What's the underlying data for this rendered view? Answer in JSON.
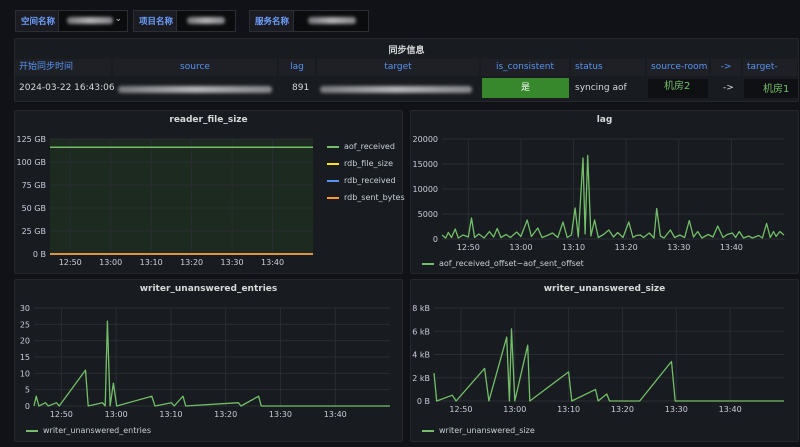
{
  "variables": [
    {
      "label": "空间名称"
    },
    {
      "label": "项目名称"
    },
    {
      "label": "服务名称"
    }
  ],
  "sync_table": {
    "title": "同步信息",
    "columns": [
      "开始同步时间",
      "source",
      "lag",
      "target",
      "is_consistent",
      "status",
      "source-room",
      "->",
      "target-room"
    ],
    "row": {
      "start_time": "2024-03-22 16:43:06",
      "lag": "891",
      "is_consistent": "是",
      "status": "syncing aof",
      "source_room": "机房2",
      "arrow": "->",
      "target_room": "机房1"
    },
    "colors": {
      "consistent_bg": "#37872d",
      "room_text": "#73bf69",
      "header_text": "#5794f2"
    }
  },
  "x_ticks": [
    "12:50",
    "13:00",
    "13:10",
    "13:20",
    "13:30",
    "13:40"
  ],
  "panels": {
    "reader": {
      "title": "reader_file_size"
    },
    "lag": {
      "title": "lag"
    },
    "writer_entries": {
      "title": "writer_unanswered_entries"
    },
    "writer_size": {
      "title": "writer_unanswered_size"
    }
  },
  "chart_data": [
    {
      "type": "line",
      "title": "reader_file_size",
      "x_range": [
        "12:45",
        "13:47"
      ],
      "ylim": [
        0,
        125
      ],
      "y_ticks": [
        "0 B",
        "25 GB",
        "50 GB",
        "75 GB",
        "100 GB",
        "125 GB"
      ],
      "legend_position": "right",
      "series": [
        {
          "name": "aof_received",
          "color": "#73bf69",
          "constant": 116
        },
        {
          "name": "rdb_file_size",
          "color": "#fade2a",
          "constant": 0
        },
        {
          "name": "rdb_received",
          "color": "#5794f2",
          "constant": 0
        },
        {
          "name": "rdb_sent_bytes",
          "color": "#ff9830",
          "constant": 0
        }
      ]
    },
    {
      "type": "line",
      "title": "lag",
      "x_range": [
        "12:45",
        "13:47"
      ],
      "ylim": [
        0,
        20000
      ],
      "y_ticks": [
        "0",
        "5000",
        "10000",
        "15000",
        "20000"
      ],
      "legend_position": "bottom",
      "series": [
        {
          "name": "aof_received_offset−aof_sent_offset",
          "color": "#73bf69",
          "points": [
            [
              0,
              800
            ],
            [
              0.7,
              200
            ],
            [
              1.2,
              1300
            ],
            [
              1.8,
              300
            ],
            [
              2.5,
              2000
            ],
            [
              3.1,
              200
            ],
            [
              4,
              800
            ],
            [
              5,
              400
            ],
            [
              5.6,
              4200
            ],
            [
              6.2,
              300
            ],
            [
              7,
              1000
            ],
            [
              8,
              200
            ],
            [
              9,
              1500
            ],
            [
              9.8,
              400
            ],
            [
              10.5,
              2100
            ],
            [
              11.2,
              300
            ],
            [
              12.2,
              900
            ],
            [
              13,
              300
            ],
            [
              14.2,
              1400
            ],
            [
              15,
              500
            ],
            [
              16.2,
              3800
            ],
            [
              17,
              500
            ],
            [
              18.2,
              2200
            ],
            [
              19,
              300
            ],
            [
              20,
              700
            ],
            [
              21,
              1200
            ],
            [
              22,
              300
            ],
            [
              23,
              3400
            ],
            [
              23.8,
              300
            ],
            [
              24.6,
              800
            ],
            [
              25.3,
              6200
            ],
            [
              25.9,
              400
            ],
            [
              26.8,
              16200
            ],
            [
              27.2,
              1000
            ],
            [
              27.7,
              16700
            ],
            [
              28.3,
              600
            ],
            [
              29,
              3800
            ],
            [
              29.7,
              300
            ],
            [
              30.7,
              900
            ],
            [
              31.7,
              1800
            ],
            [
              32.6,
              400
            ],
            [
              33.4,
              1300
            ],
            [
              34.4,
              300
            ],
            [
              35.5,
              3400
            ],
            [
              36.3,
              300
            ],
            [
              36.9,
              700
            ],
            [
              37.7,
              800
            ],
            [
              38.3,
              300
            ],
            [
              39.4,
              1200
            ],
            [
              40.3,
              200
            ],
            [
              40.8,
              6100
            ],
            [
              41.5,
              600
            ],
            [
              42.2,
              200
            ],
            [
              43.4,
              1800
            ],
            [
              44.2,
              300
            ],
            [
              45.2,
              800
            ],
            [
              46.1,
              300
            ],
            [
              47,
              3700
            ],
            [
              47.8,
              400
            ],
            [
              48.6,
              1500
            ],
            [
              49.4,
              200
            ],
            [
              50.6,
              900
            ],
            [
              51.5,
              400
            ],
            [
              52.4,
              2600
            ],
            [
              53.4,
              300
            ],
            [
              54.2,
              900
            ],
            [
              55.2,
              1200
            ],
            [
              55.8,
              300
            ],
            [
              56.5,
              1500
            ],
            [
              57.3,
              200
            ],
            [
              58.3,
              600
            ],
            [
              59,
              200
            ],
            [
              60.2,
              700
            ],
            [
              60.9,
              200
            ],
            [
              61.7,
              3100
            ],
            [
              62.4,
              300
            ],
            [
              63,
              1500
            ],
            [
              63.5,
              500
            ],
            [
              64.2,
              1500
            ],
            [
              65,
              800
            ]
          ]
        }
      ]
    },
    {
      "type": "line",
      "title": "writer_unanswered_entries",
      "x_range": [
        "12:45",
        "13:47"
      ],
      "ylim": [
        0,
        30
      ],
      "y_ticks": [
        "0",
        "5",
        "10",
        "15",
        "20",
        "25",
        "30"
      ],
      "legend_position": "bottom",
      "series": [
        {
          "name": "writer_unanswered_entries",
          "color": "#73bf69",
          "points": [
            [
              0,
              0
            ],
            [
              0.4,
              3
            ],
            [
              0.9,
              0
            ],
            [
              2.1,
              1
            ],
            [
              2.6,
              0
            ],
            [
              4.1,
              1
            ],
            [
              4.6,
              0
            ],
            [
              9.4,
              11
            ],
            [
              9.9,
              0
            ],
            [
              12.5,
              1
            ],
            [
              13,
              0
            ],
            [
              13.4,
              26
            ],
            [
              13.9,
              0
            ],
            [
              14.5,
              7
            ],
            [
              15.1,
              0
            ],
            [
              21.5,
              3
            ],
            [
              22.1,
              0
            ],
            [
              25.1,
              1
            ],
            [
              25.6,
              0
            ],
            [
              27.2,
              3
            ],
            [
              27.7,
              0
            ],
            [
              37.3,
              1
            ],
            [
              37.8,
              0
            ],
            [
              41,
              3
            ],
            [
              41.5,
              0
            ],
            [
              65,
              0
            ]
          ]
        }
      ]
    },
    {
      "type": "line",
      "title": "writer_unanswered_size",
      "x_range": [
        "12:45",
        "13:47"
      ],
      "ylim": [
        0,
        8
      ],
      "y_ticks": [
        "0 B",
        "2 kB",
        "4 kB",
        "6 kB",
        "8 kB"
      ],
      "legend_position": "bottom",
      "series": [
        {
          "name": "writer_unanswered_size",
          "color": "#73bf69",
          "points": [
            [
              0,
              2.4
            ],
            [
              0.5,
              0
            ],
            [
              3.4,
              0.5
            ],
            [
              4.1,
              0
            ],
            [
              9.4,
              2.8
            ],
            [
              10.2,
              0
            ],
            [
              13.5,
              5.5
            ],
            [
              14,
              0
            ],
            [
              14.4,
              6.2
            ],
            [
              15,
              0
            ],
            [
              17.4,
              4.8
            ],
            [
              17.8,
              0
            ],
            [
              25,
              2.5
            ],
            [
              25.6,
              0
            ],
            [
              30,
              1
            ],
            [
              30.5,
              0
            ],
            [
              32.1,
              0.6
            ],
            [
              32.6,
              0
            ],
            [
              36.3,
              0
            ],
            [
              38.2,
              0
            ],
            [
              44.1,
              3.4
            ],
            [
              44.8,
              0
            ],
            [
              65,
              0
            ]
          ]
        }
      ]
    }
  ]
}
